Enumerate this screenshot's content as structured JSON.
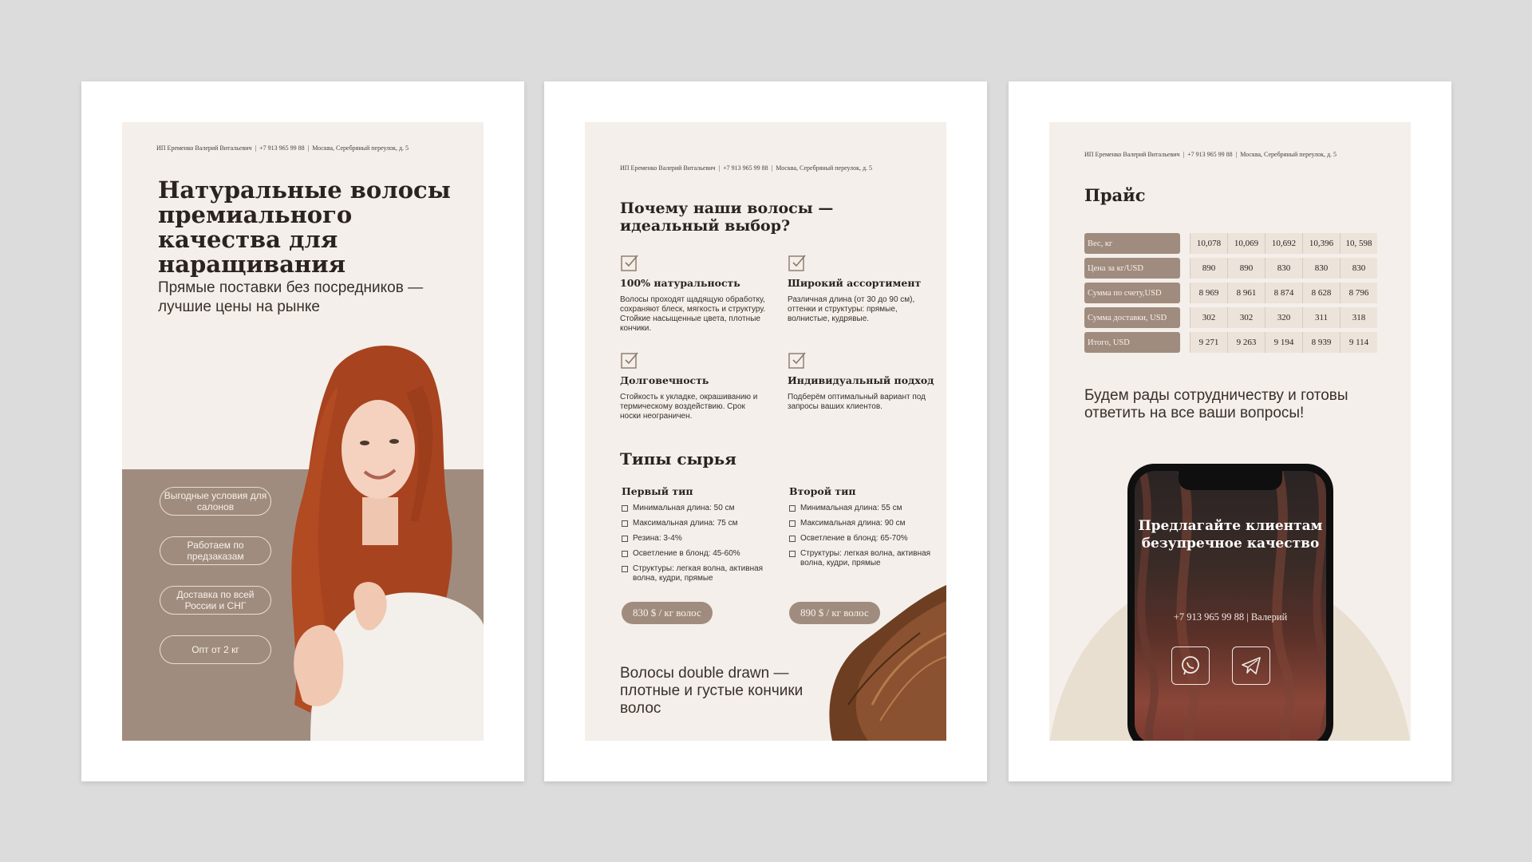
{
  "contact": {
    "name": "ИП Еременко Валерий Витальевич",
    "phone": "+7 913 965 99 88",
    "address": "Москва, Серебряный переулок, д. 5"
  },
  "page1": {
    "title": "Натуральные волосы премиального качества для наращивания",
    "subtitle": "Прямые поставки без посредников — лучшие цены на рынке",
    "pills": [
      "Выгодные условия для салонов",
      "Работаем по предзаказам",
      "Доставка по всей России и СНГ",
      "Опт от 2 кг"
    ]
  },
  "page2": {
    "why_title": "Почему наши волосы — идеальный выбор?",
    "features": [
      {
        "title": "100% натуральность",
        "text": "Волосы проходят щадящую обработку, сохраняют блеск, мягкость и структуру. Стойкие насыщенные цвета, плотные кончики."
      },
      {
        "title": "Широкий ассортимент",
        "text": "Различная длина (от 30 до 90 см), оттенки и структуры: прямые, волнистые, кудрявые."
      },
      {
        "title": "Долговечность",
        "text": "Стойкость к укладке, окрашиванию и термическому воздействию. Срок носки неограничен."
      },
      {
        "title": "Индивидуальный подход",
        "text": "Подберём оптимальный вариант под запросы ваших клиентов."
      }
    ],
    "types_title": "Типы сырья",
    "types": [
      {
        "title": "Первый тип",
        "items": [
          "Минимальная длина: 50 см",
          "Максимальная длина: 75 см",
          "Резина: 3-4%",
          "Осветление в блонд: 45-60%",
          "Структуры: легкая волна, активная волна, кудри, прямые"
        ],
        "price": "830 $ / кг волос"
      },
      {
        "title": "Второй тип",
        "items": [
          "Минимальная длина: 55 см",
          "Максимальная длина: 90 см",
          "Осветление в блонд: 65-70%",
          "Структуры: легкая волна, активная волна, кудри, прямые"
        ],
        "price": "890 $ / кг волос"
      }
    ],
    "footer": "Волосы double drawn — плотные и густые кончики волос"
  },
  "page3": {
    "title": "Прайс",
    "rows": [
      {
        "label": "Вес, кг",
        "values": [
          "10,078",
          "10,069",
          "10,692",
          "10,396",
          "10, 598"
        ]
      },
      {
        "label": "Цена за кг/USD",
        "values": [
          "890",
          "890",
          "830",
          "830",
          "830"
        ]
      },
      {
        "label": "Сумма по счету,USD",
        "values": [
          "8 969",
          "8 961",
          "8 874",
          "8 628",
          "8 796"
        ]
      },
      {
        "label": "Сумма доставки, USD",
        "values": [
          "302",
          "302",
          "320",
          "311",
          "318"
        ]
      },
      {
        "label": "Итого, USD",
        "values": [
          "9 271",
          "9 263",
          "9 194",
          "8 939",
          "9 114"
        ]
      }
    ],
    "thanks": "Будем рады сотрудничеству и готовы ответить на все ваши вопросы!",
    "phone_screen": {
      "title": "Предлагайте клиентам безупречное качество",
      "contact": "+7 913 965 99 88 | Валерий",
      "icons": [
        "whatsapp-icon",
        "telegram-icon"
      ]
    }
  },
  "colors": {
    "accent": "#a08c7e",
    "page_bg": "#f4efea",
    "text": "#2b2320",
    "backdrop": "#dcdcdc"
  }
}
